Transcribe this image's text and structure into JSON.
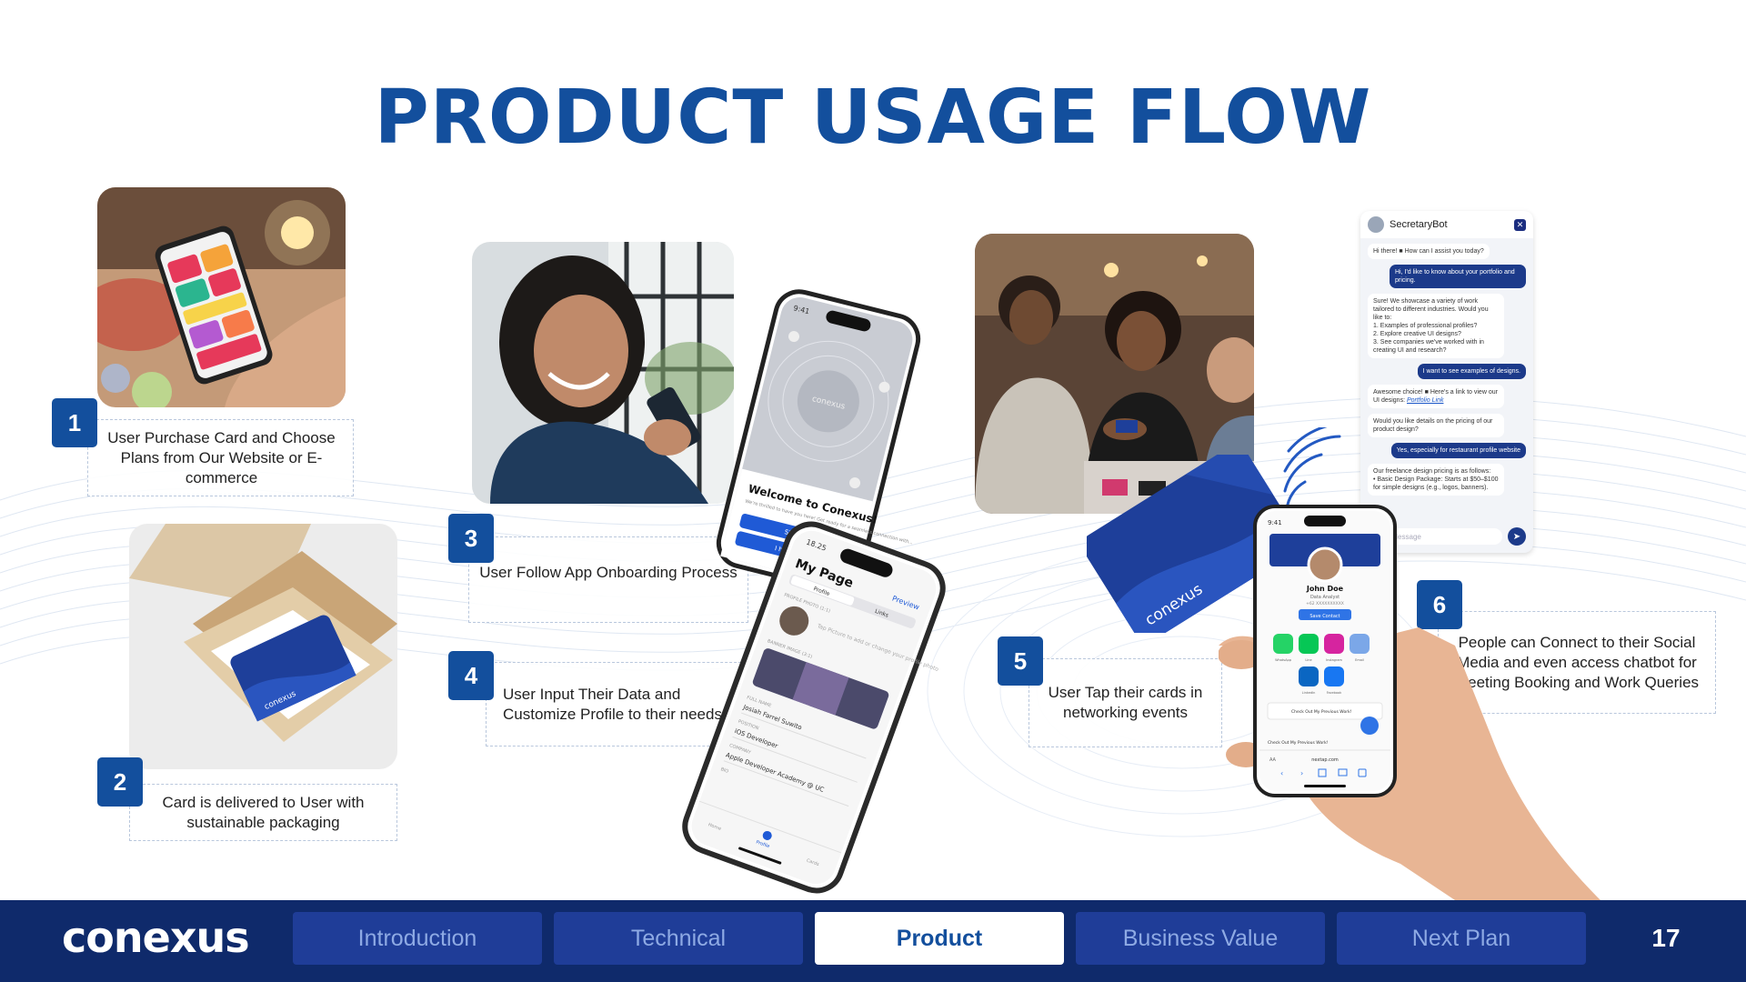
{
  "title": "PRODUCT USAGE FLOW",
  "steps": [
    {
      "num": "1",
      "text": "User Purchase Card and Choose Plans from Our Website or E-commerce"
    },
    {
      "num": "2",
      "text": "Card is delivered to User with sustainable packaging"
    },
    {
      "num": "3",
      "text": "User Follow App Onboarding Process"
    },
    {
      "num": "4",
      "text": "User Input Their Data and Customize Profile to their needs"
    },
    {
      "num": "5",
      "text": "User Tap their cards in networking events"
    },
    {
      "num": "6",
      "text": "People can Connect to their Social Media and even access chatbot for Meeting Booking and Work Queries"
    }
  ],
  "onboarding_phone": {
    "time": "9:41",
    "brand": "conexus",
    "welcome": "Welcome to Conexus!",
    "sub": "We're thrilled to have you here! Get ready for a seamless connection with...",
    "primary_button": "Sign in",
    "secondary_button": "I have an..."
  },
  "mypage_phone": {
    "time": "18.25",
    "title": "My Page",
    "preview": "Preview",
    "tab_profile": "Profile",
    "tab_links": "Links",
    "section_photo": "PROFILE PHOTO (1:1)",
    "photo_hint": "Tap Picture to add or change your profile photo",
    "section_banner": "BANNER IMAGE (3:1)",
    "label_name": "FULL NAME",
    "value_name": "Josiah Farrel Suwito",
    "label_position": "POSITION",
    "value_position": "iOS Developer",
    "label_company": "COMPANY",
    "value_company": "Apple Developer Academy @ UC",
    "label_bio": "BIO",
    "nav_home": "Home",
    "nav_profile": "Profile",
    "nav_cards": "Cards"
  },
  "card_brand": "conexus",
  "profile_phone": {
    "time": "9:41",
    "name": "John Doe",
    "role": "Data Analyst",
    "phone": "+62 XXXXXXXXXX",
    "save_button": "Save Contact",
    "social": [
      "WhatsApp",
      "Line",
      "Instagram",
      "Email",
      "LinkedIn",
      "Facebook"
    ],
    "work_label": "Check Out My Previous Work!",
    "url": "nextap.com",
    "aa": "AA"
  },
  "chatbot": {
    "name": "SecretaryBot",
    "messages": [
      {
        "role": "bot",
        "text": "Hi there! ■ How can I assist you today?"
      },
      {
        "role": "user",
        "text": "Hi, I'd like to know about your portfolio and pricing."
      },
      {
        "role": "bot",
        "text": "Sure! We showcase a variety of work tailored to different industries. Would you like to:\n1. Examples of professional profiles?\n2. Explore creative UI designs?\n3. See companies we've worked with in creating UI and research?"
      },
      {
        "role": "user",
        "text": "I want to see examples of designs."
      },
      {
        "role": "bot",
        "text": "Awesome choice! ■ Here's a link to view our UI designs:",
        "link": "Portfolio Link"
      },
      {
        "role": "bot",
        "text": "Would you like details on the pricing of our product design?"
      },
      {
        "role": "user",
        "text": "Yes, especially for restaurant profile website"
      },
      {
        "role": "bot",
        "text": "Our freelance design pricing is as follows:\n• Basic Design Package: Starts at $50–$100 for simple designs (e.g., logos, banners)."
      }
    ],
    "placeholder": "Your Message"
  },
  "footer": {
    "logo": "conexus",
    "tabs": [
      "Introduction",
      "Technical",
      "Product",
      "Business Value",
      "Next Plan"
    ],
    "active_tab": "Product",
    "page": "17"
  },
  "colors": {
    "primary": "#134f9d",
    "footer_bg": "#0f2a6b",
    "tab_bg": "#1f3d98",
    "tab_text": "#8eaae4",
    "card_blue": "#1e3f9a"
  }
}
